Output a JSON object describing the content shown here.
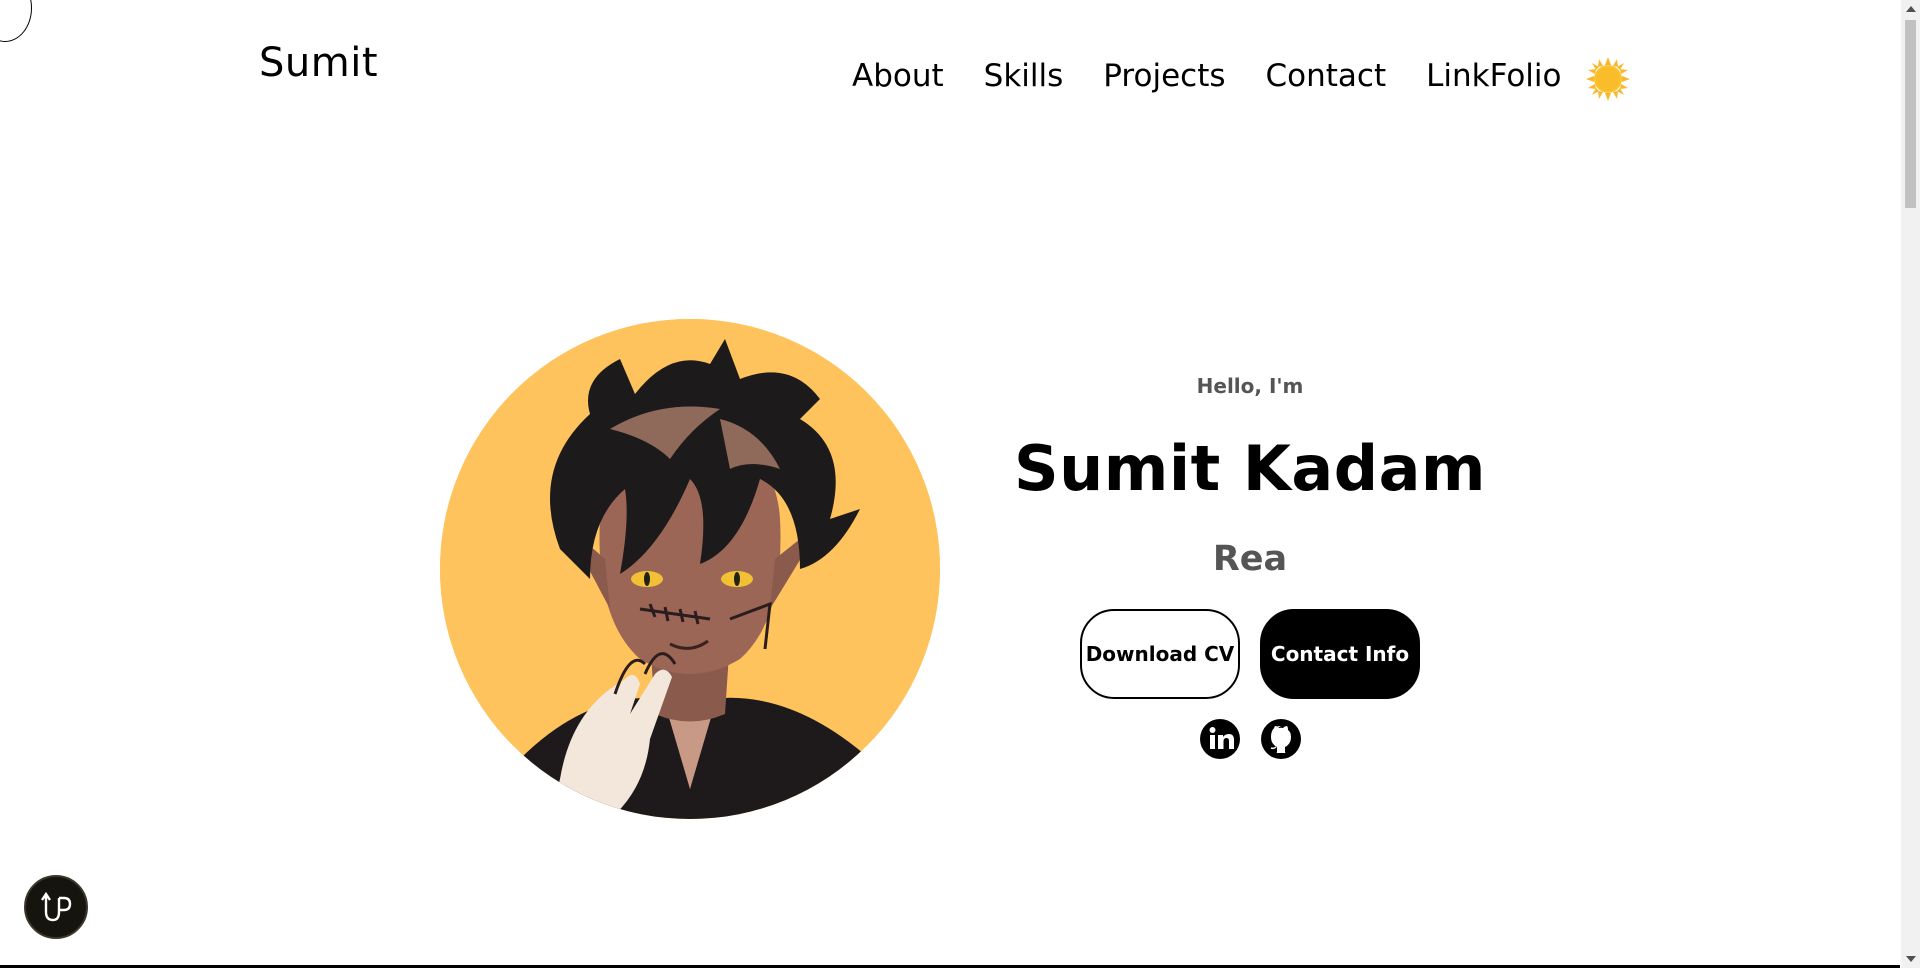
{
  "header": {
    "logo": "Sumit",
    "nav": [
      "About",
      "Skills",
      "Projects",
      "Contact",
      "LinkFolio"
    ],
    "theme_icon": "sun-icon"
  },
  "hero": {
    "greeting": "Hello, I'm",
    "name": "Sumit Kadam",
    "role_typing": "Rea",
    "buttons": {
      "download": "Download CV",
      "contact": "Contact Info"
    },
    "socials": [
      "linkedin-icon",
      "github-icon"
    ],
    "avatar_icon": "profile-avatar"
  },
  "floating": {
    "up_icon": "scroll-up-icon"
  },
  "colors": {
    "accent": "#fec35c",
    "text": "#000000",
    "muted": "#555555",
    "sun": "#f7b92c"
  }
}
